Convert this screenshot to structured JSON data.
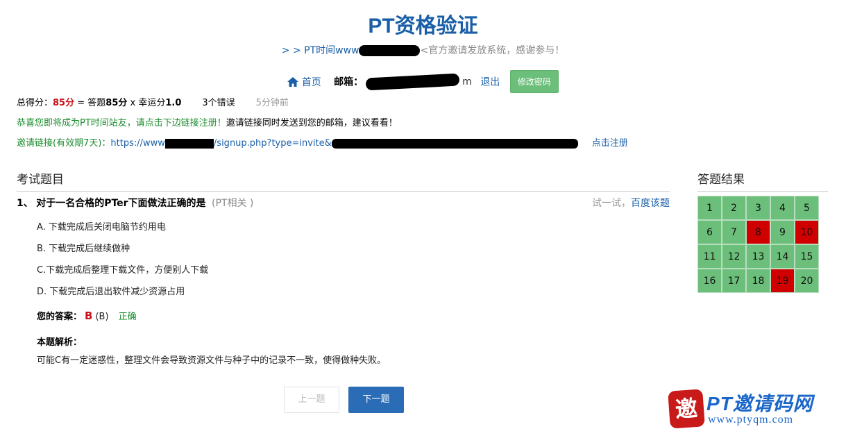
{
  "site": {
    "title": "PT资格验证",
    "subtitle_prefix": "> > PT时间www",
    "subtitle_tail": "<官方邀请发放系统，感谢参与！"
  },
  "nav": {
    "home": "首页",
    "email_label": "邮箱：",
    "email_tail": "m",
    "logout": "退出",
    "change_password": "修改密码"
  },
  "score": {
    "label": "总得分：",
    "total": "85分",
    "eq": " = 答题",
    "answer_score": "85分",
    "times": " x 幸运分",
    "luck": "1.0",
    "errors": "3个错误",
    "time_ago": "5分钟前"
  },
  "congrats": {
    "green": "恭喜您即将成为PT时间站友，请点击下边链接注册！",
    "black": "邀请链接同时发送到您的邮箱，建议看看！"
  },
  "invite": {
    "label": "邀请链接(有效期7天)：",
    "url_start": "https://www",
    "url_mid": "/signup.php?type=invite&",
    "register": "点击注册"
  },
  "sections": {
    "exam": "考试题目",
    "results": "答题结果"
  },
  "question": {
    "number": "1、",
    "text": "对于一名合格的PTer下面做法正确的是",
    "tag": "(PT相关 )",
    "try_label": "试一试，",
    "baidu": "百度该题",
    "options": [
      "A. 下载完成后关闭电脑节约用电",
      "B. 下载完成后继续做种",
      "C.下载完成后整理下载文件，方便别人下载",
      "D. 下载完成后退出软件减少资源占用"
    ],
    "your_answer_label": "您的答案：",
    "your_answer": "B",
    "correct_answer": "(B)",
    "verdict": "正确",
    "analysis_title": "本题解析：",
    "analysis": "可能C有一定迷惑性，整理文件会导致资源文件与种子中的记录不一致，使得做种失败。"
  },
  "pager": {
    "prev": "上一题",
    "next": "下一题"
  },
  "results_grid": {
    "cells": [
      "1",
      "2",
      "3",
      "4",
      "5",
      "6",
      "7",
      "8",
      "9",
      "10",
      "11",
      "12",
      "13",
      "14",
      "15",
      "16",
      "17",
      "18",
      "19",
      "20"
    ],
    "wrong": [
      "8",
      "10",
      "19"
    ]
  },
  "colors": {
    "correct": "#6cbf7a",
    "wrong": "#d10000",
    "primary": "#2a6db6",
    "title": "#1a5fa8"
  },
  "watermark": {
    "seal": "邀",
    "name": "PT邀请码网",
    "url": "www.ptyqm.com"
  }
}
